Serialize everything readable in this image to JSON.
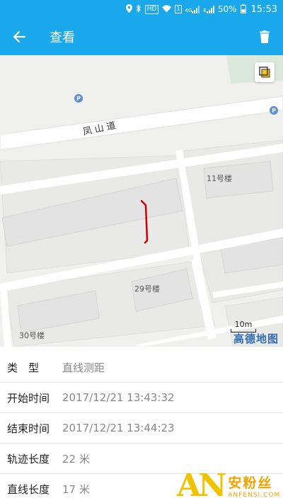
{
  "status_bar": {
    "hd": "HD",
    "sim_slot": "1",
    "network_4g": "4G",
    "network_e": "E",
    "battery": "50%",
    "time": "15:53"
  },
  "app_bar": {
    "title": "查看",
    "back_icon": "arrow-left",
    "delete_icon": "trash"
  },
  "map": {
    "road_name": "凤山道",
    "buildings": [
      "11号楼",
      "29号楼",
      "30号楼"
    ],
    "poi_symbol": "P",
    "scale": "10m",
    "brand": "高德地图",
    "track_color": "#cc0000"
  },
  "details": [
    {
      "label": "类　型",
      "value": "直线测距"
    },
    {
      "label": "开始时间",
      "value": "2017/12/21 13:43:32"
    },
    {
      "label": "结束时间",
      "value": "2017/12/21 13:44:23"
    },
    {
      "label": "轨迹长度",
      "value": "22 米"
    },
    {
      "label": "直线长度",
      "value": "17 米"
    }
  ],
  "watermark": {
    "logo": "AN",
    "name": "安粉丝",
    "domain": "ANFENSI.COM"
  },
  "colors": {
    "primary": "#1aa8ec",
    "label": "#222222",
    "value": "#888888"
  }
}
